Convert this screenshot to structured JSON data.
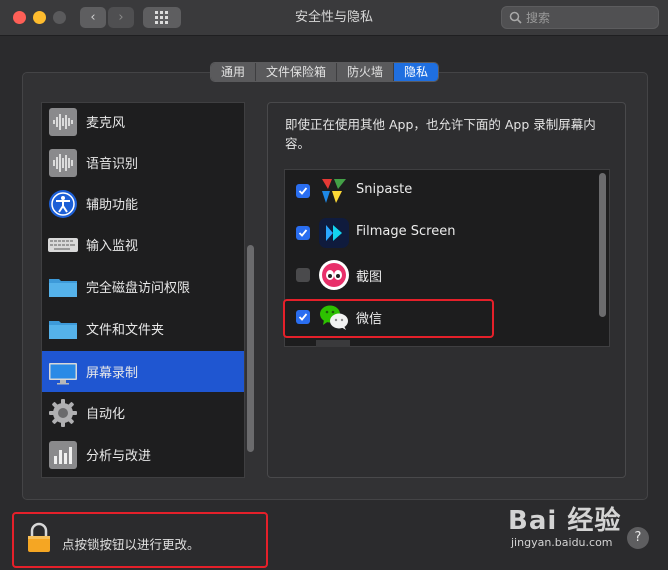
{
  "window": {
    "title": "安全性与隐私",
    "search_placeholder": "搜索",
    "nav_back": "‹",
    "nav_forward": "›"
  },
  "tabs": [
    {
      "label": "通用",
      "active": false
    },
    {
      "label": "文件保险箱",
      "active": false
    },
    {
      "label": "防火墙",
      "active": false
    },
    {
      "label": "隐私",
      "active": true
    }
  ],
  "sidebar": {
    "items": [
      {
        "label": "麦克风",
        "icon": "microphone-icon"
      },
      {
        "label": "语音识别",
        "icon": "speech-recognition-icon"
      },
      {
        "label": "辅助功能",
        "icon": "accessibility-icon"
      },
      {
        "label": "输入监视",
        "icon": "keyboard-icon"
      },
      {
        "label": "完全磁盘访问权限",
        "icon": "folder-icon"
      },
      {
        "label": "文件和文件夹",
        "icon": "folder-icon"
      },
      {
        "label": "屏幕录制",
        "icon": "display-icon",
        "selected": true
      },
      {
        "label": "自动化",
        "icon": "gear-icon"
      },
      {
        "label": "分析与改进",
        "icon": "chart-icon"
      }
    ]
  },
  "main": {
    "description": "即使正在使用其他 App，也允许下面的 App 录制屏幕内容。",
    "apps": [
      {
        "name": "Snipaste",
        "checked": true,
        "icon": "snipaste-icon"
      },
      {
        "name": "Filmage Screen",
        "checked": true,
        "icon": "filmage-icon"
      },
      {
        "name": "截图",
        "checked": false,
        "icon": "screenshot-app-icon"
      },
      {
        "name": "微信",
        "checked": true,
        "icon": "wechat-icon"
      }
    ]
  },
  "footer": {
    "lock_text": "点按锁按钮以进行更改。",
    "help_label": "?"
  },
  "watermark": {
    "logo": "Bai 经验",
    "url": "jingyan.baidu.com"
  },
  "colors": {
    "accent": "#1f56d1",
    "checkbox": "#2a6ef0",
    "highlight": "#e5202a"
  }
}
